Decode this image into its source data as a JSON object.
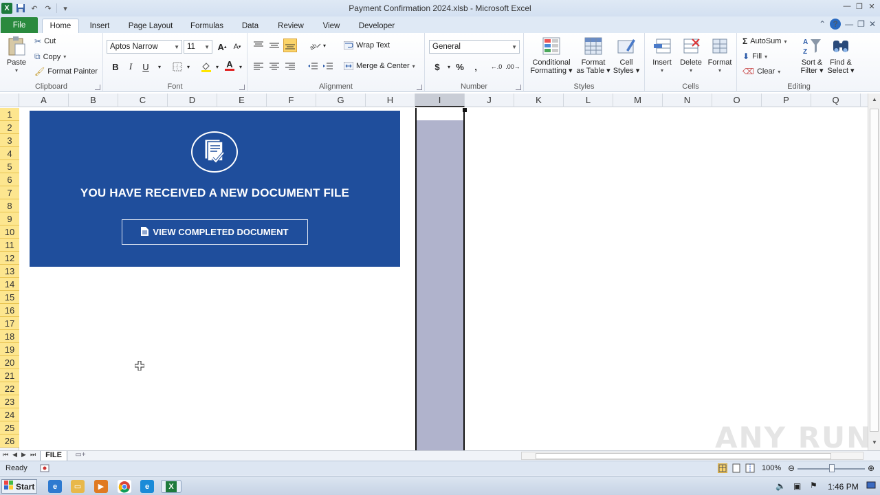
{
  "window": {
    "title": "Payment Confirmation 2024.xlsb  -  Microsoft Excel"
  },
  "ribbon_tabs": [
    "File",
    "Home",
    "Insert",
    "Page Layout",
    "Formulas",
    "Data",
    "Review",
    "View",
    "Developer"
  ],
  "clipboard": {
    "paste": "Paste",
    "cut": "Cut",
    "copy": "Copy",
    "format_painter": "Format Painter",
    "label": "Clipboard"
  },
  "font": {
    "name": "Aptos Narrow",
    "size": "11",
    "bold": "B",
    "italic": "I",
    "underline": "U",
    "label": "Font"
  },
  "alignment": {
    "wrap_text": "Wrap Text",
    "merge_center": "Merge & Center",
    "label": "Alignment"
  },
  "number": {
    "format": "General",
    "currency": "$",
    "percent": "%",
    "comma": ",",
    "label": "Number"
  },
  "styles": {
    "conditional": [
      "Conditional",
      "Formatting"
    ],
    "format_table": [
      "Format",
      "as Table"
    ],
    "cell_styles": [
      "Cell",
      "Styles"
    ],
    "label": "Styles"
  },
  "cells": {
    "insert": "Insert",
    "delete": "Delete",
    "format": "Format",
    "label": "Cells"
  },
  "editing": {
    "autosum": "AutoSum",
    "fill": "Fill",
    "clear": "Clear",
    "sort": [
      "Sort &",
      "Filter"
    ],
    "find": [
      "Find &",
      "Select"
    ],
    "label": "Editing"
  },
  "columns": [
    "A",
    "B",
    "C",
    "D",
    "E",
    "F",
    "G",
    "H",
    "I",
    "J",
    "K",
    "L",
    "M",
    "N",
    "O",
    "P",
    "Q"
  ],
  "selected_column": "I",
  "rows": [
    "1",
    "2",
    "3",
    "4",
    "5",
    "6",
    "7",
    "8",
    "9",
    "10",
    "11",
    "12",
    "13",
    "14",
    "15",
    "16",
    "17",
    "18",
    "19",
    "20",
    "21",
    "22",
    "23",
    "24",
    "25",
    "26"
  ],
  "banner": {
    "heading": "YOU HAVE RECEIVED A NEW DOCUMENT FILE",
    "button": "VIEW COMPLETED DOCUMENT",
    "color": "#1f4e9c"
  },
  "sheet_tab": "FILE",
  "status": {
    "text": "Ready",
    "zoom": "100%"
  },
  "taskbar": {
    "start": "Start",
    "clock": "1:46 PM"
  },
  "watermark": "ANY RUN"
}
